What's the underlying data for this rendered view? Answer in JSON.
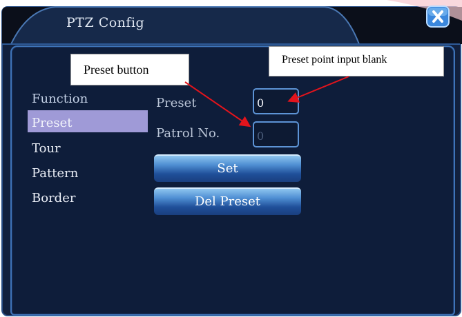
{
  "window": {
    "title": "PTZ Config",
    "close_icon": "close-icon"
  },
  "menu": {
    "header": "Function",
    "items": [
      {
        "label": "Preset",
        "selected": true
      },
      {
        "label": "Tour",
        "selected": false
      },
      {
        "label": "Pattern",
        "selected": false
      },
      {
        "label": "Border",
        "selected": false
      }
    ]
  },
  "form": {
    "preset_label": "Preset",
    "preset_value": "0",
    "patrol_label": "Patrol No.",
    "patrol_value": "0",
    "set_button": "Set",
    "del_preset_button": "Del Preset"
  },
  "annotations": {
    "preset_button_callout": "Preset button",
    "preset_input_callout": "Preset point input blank",
    "arrow_color": "#e3141c"
  },
  "colors": {
    "panel_bg": "#0e1d3a",
    "border_blue": "#3e74b8",
    "selection": "#9f9ad7",
    "button_gradient_top": "#8ec5ef",
    "button_gradient_bottom": "#1a3f7f"
  }
}
